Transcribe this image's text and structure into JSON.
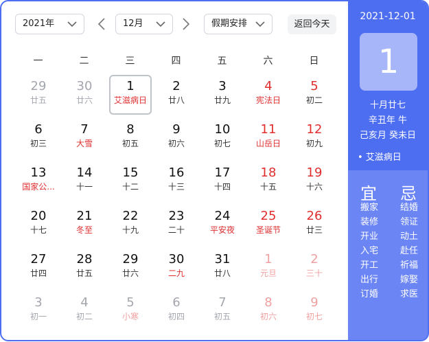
{
  "toolbar": {
    "year_label": "2021年",
    "month_label": "12月",
    "holiday_label": "假期安排",
    "today_label": "返回今天"
  },
  "weekdays": [
    "一",
    "二",
    "三",
    "四",
    "五",
    "六",
    "日"
  ],
  "weeks": [
    [
      {
        "num": "29",
        "lunar": "廿五",
        "tone": "grey"
      },
      {
        "num": "30",
        "lunar": "廿六",
        "tone": "grey"
      },
      {
        "num": "1",
        "lunar": "艾滋病日",
        "tone": "normal",
        "lunar_red": true,
        "selected": true
      },
      {
        "num": "2",
        "lunar": "廿八",
        "tone": "normal"
      },
      {
        "num": "3",
        "lunar": "廿九",
        "tone": "normal"
      },
      {
        "num": "4",
        "lunar": "宪法日",
        "tone": "red",
        "lunar_red": true
      },
      {
        "num": "5",
        "lunar": "初二",
        "tone": "red"
      }
    ],
    [
      {
        "num": "6",
        "lunar": "初三",
        "tone": "normal"
      },
      {
        "num": "7",
        "lunar": "大雪",
        "tone": "normal",
        "lunar_red": true
      },
      {
        "num": "8",
        "lunar": "初五",
        "tone": "normal"
      },
      {
        "num": "9",
        "lunar": "初六",
        "tone": "normal"
      },
      {
        "num": "10",
        "lunar": "初七",
        "tone": "normal"
      },
      {
        "num": "11",
        "lunar": "山岳日",
        "tone": "red",
        "lunar_red": true
      },
      {
        "num": "12",
        "lunar": "初九",
        "tone": "red"
      }
    ],
    [
      {
        "num": "13",
        "lunar": "国家公...",
        "tone": "normal",
        "lunar_red": true
      },
      {
        "num": "14",
        "lunar": "十一",
        "tone": "normal"
      },
      {
        "num": "15",
        "lunar": "十二",
        "tone": "normal"
      },
      {
        "num": "16",
        "lunar": "十三",
        "tone": "normal"
      },
      {
        "num": "17",
        "lunar": "十四",
        "tone": "normal"
      },
      {
        "num": "18",
        "lunar": "十五",
        "tone": "red"
      },
      {
        "num": "19",
        "lunar": "十六",
        "tone": "red"
      }
    ],
    [
      {
        "num": "20",
        "lunar": "十七",
        "tone": "normal"
      },
      {
        "num": "21",
        "lunar": "冬至",
        "tone": "normal",
        "lunar_red": true
      },
      {
        "num": "22",
        "lunar": "十九",
        "tone": "normal"
      },
      {
        "num": "23",
        "lunar": "二十",
        "tone": "normal"
      },
      {
        "num": "24",
        "lunar": "平安夜",
        "tone": "normal",
        "lunar_red": true
      },
      {
        "num": "25",
        "lunar": "圣诞节",
        "tone": "red",
        "lunar_red": true
      },
      {
        "num": "26",
        "lunar": "廿三",
        "tone": "red"
      }
    ],
    [
      {
        "num": "27",
        "lunar": "廿四",
        "tone": "normal"
      },
      {
        "num": "28",
        "lunar": "廿五",
        "tone": "normal"
      },
      {
        "num": "29",
        "lunar": "廿六",
        "tone": "normal"
      },
      {
        "num": "30",
        "lunar": "二九",
        "tone": "normal",
        "lunar_red": true
      },
      {
        "num": "31",
        "lunar": "廿八",
        "tone": "normal"
      },
      {
        "num": "1",
        "lunar": "元旦",
        "tone": "pink",
        "lunar_pink": true
      },
      {
        "num": "2",
        "lunar": "三十",
        "tone": "pink"
      }
    ],
    [
      {
        "num": "3",
        "lunar": "初一",
        "tone": "grey"
      },
      {
        "num": "4",
        "lunar": "初二",
        "tone": "grey"
      },
      {
        "num": "5",
        "lunar": "小寒",
        "tone": "grey",
        "lunar_pink": true
      },
      {
        "num": "6",
        "lunar": "初四",
        "tone": "grey"
      },
      {
        "num": "7",
        "lunar": "初五",
        "tone": "grey"
      },
      {
        "num": "8",
        "lunar": "初六",
        "tone": "pink"
      },
      {
        "num": "9",
        "lunar": "初七",
        "tone": "pink"
      }
    ]
  ],
  "side": {
    "date": "2021-12-01",
    "day": "1",
    "lunar_date": "十月廿七",
    "year_ganzhi": "辛丑年 牛",
    "month_day_ganzhi": "己亥月 癸未日",
    "festival": "• 艾滋病日",
    "yi_title": "宜",
    "ji_title": "忌",
    "yi": [
      "搬家",
      "装修",
      "开业",
      "入宅",
      "开工",
      "出行",
      "订婚"
    ],
    "ji": [
      "结婚",
      "领证",
      "动土",
      "赴任",
      "祈福",
      "嫁娶",
      "求医"
    ]
  },
  "colors": {
    "accent": "#4e6ef2",
    "side_lower": "#6b85f4",
    "holiday_red": "#e02e2e",
    "muted": "#a3a6ad"
  }
}
